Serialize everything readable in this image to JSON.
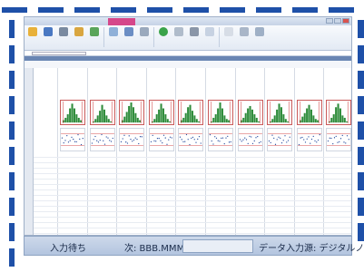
{
  "statusbar": {
    "state": "入力待ち",
    "next": "次: BBB.MMM",
    "input_source": "データ入力源: デジタルノギス"
  },
  "colors": {
    "accent": "#1e50a8",
    "histogram_bar": "#2e8b3a",
    "limit_line": "#d04040",
    "trend_point": "#2a4fa0"
  },
  "icons": [
    "open-icon",
    "save-icon",
    "print-icon",
    "chart-icon",
    "table-icon",
    "add-icon",
    "tools-icon",
    "settings-icon"
  ]
}
